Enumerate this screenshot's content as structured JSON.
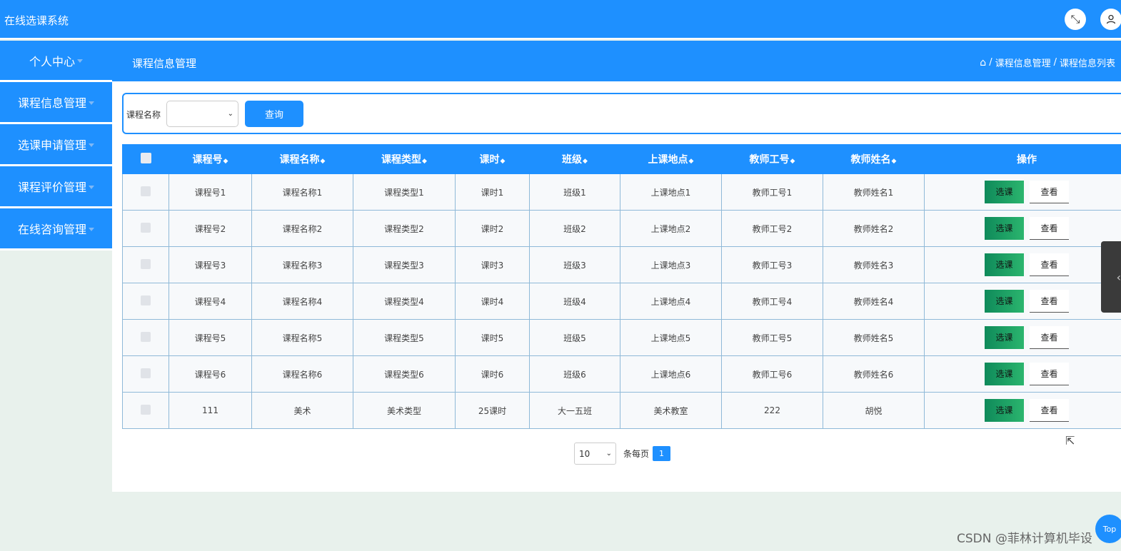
{
  "header": {
    "app_title": "在线选课系统"
  },
  "sidebar": {
    "items": [
      {
        "label": "个人中心"
      },
      {
        "label": "课程信息管理"
      },
      {
        "label": "选课申请管理"
      },
      {
        "label": "课程评价管理"
      },
      {
        "label": "在线咨询管理"
      }
    ]
  },
  "page": {
    "title": "课程信息管理",
    "breadcrumbs": [
      "课程信息管理",
      "课程信息列表"
    ],
    "separator": "/"
  },
  "search": {
    "label": "课程名称",
    "select_value": "",
    "button_label": "查询"
  },
  "table": {
    "columns": [
      "课程号",
      "课程名称",
      "课程类型",
      "课时",
      "班级",
      "上课地点",
      "教师工号",
      "教师姓名",
      "操作"
    ],
    "rows": [
      [
        "课程号1",
        "课程名称1",
        "课程类型1",
        "课时1",
        "班级1",
        "上课地点1",
        "教师工号1",
        "教师姓名1"
      ],
      [
        "课程号2",
        "课程名称2",
        "课程类型2",
        "课时2",
        "班级2",
        "上课地点2",
        "教师工号2",
        "教师姓名2"
      ],
      [
        "课程号3",
        "课程名称3",
        "课程类型3",
        "课时3",
        "班级3",
        "上课地点3",
        "教师工号3",
        "教师姓名3"
      ],
      [
        "课程号4",
        "课程名称4",
        "课程类型4",
        "课时4",
        "班级4",
        "上课地点4",
        "教师工号4",
        "教师姓名4"
      ],
      [
        "课程号5",
        "课程名称5",
        "课程类型5",
        "课时5",
        "班级5",
        "上课地点5",
        "教师工号5",
        "教师姓名5"
      ],
      [
        "课程号6",
        "课程名称6",
        "课程类型6",
        "课时6",
        "班级6",
        "上课地点6",
        "教师工号6",
        "教师姓名6"
      ],
      [
        "111",
        "美术",
        "美术类型",
        "25课时",
        "大一五班",
        "美术教室",
        "222",
        "胡悦"
      ]
    ],
    "actions": {
      "select_label": "选课",
      "view_label": "查看"
    }
  },
  "pagination": {
    "page_size": "10",
    "per_page_label": "条每页",
    "current_page": "1"
  },
  "widgets": {
    "top_label": "Top",
    "watermark": "CSDN @菲林计算机毕设"
  },
  "colors": {
    "primary": "#1e90ff",
    "select_button": "#1a9e63"
  }
}
